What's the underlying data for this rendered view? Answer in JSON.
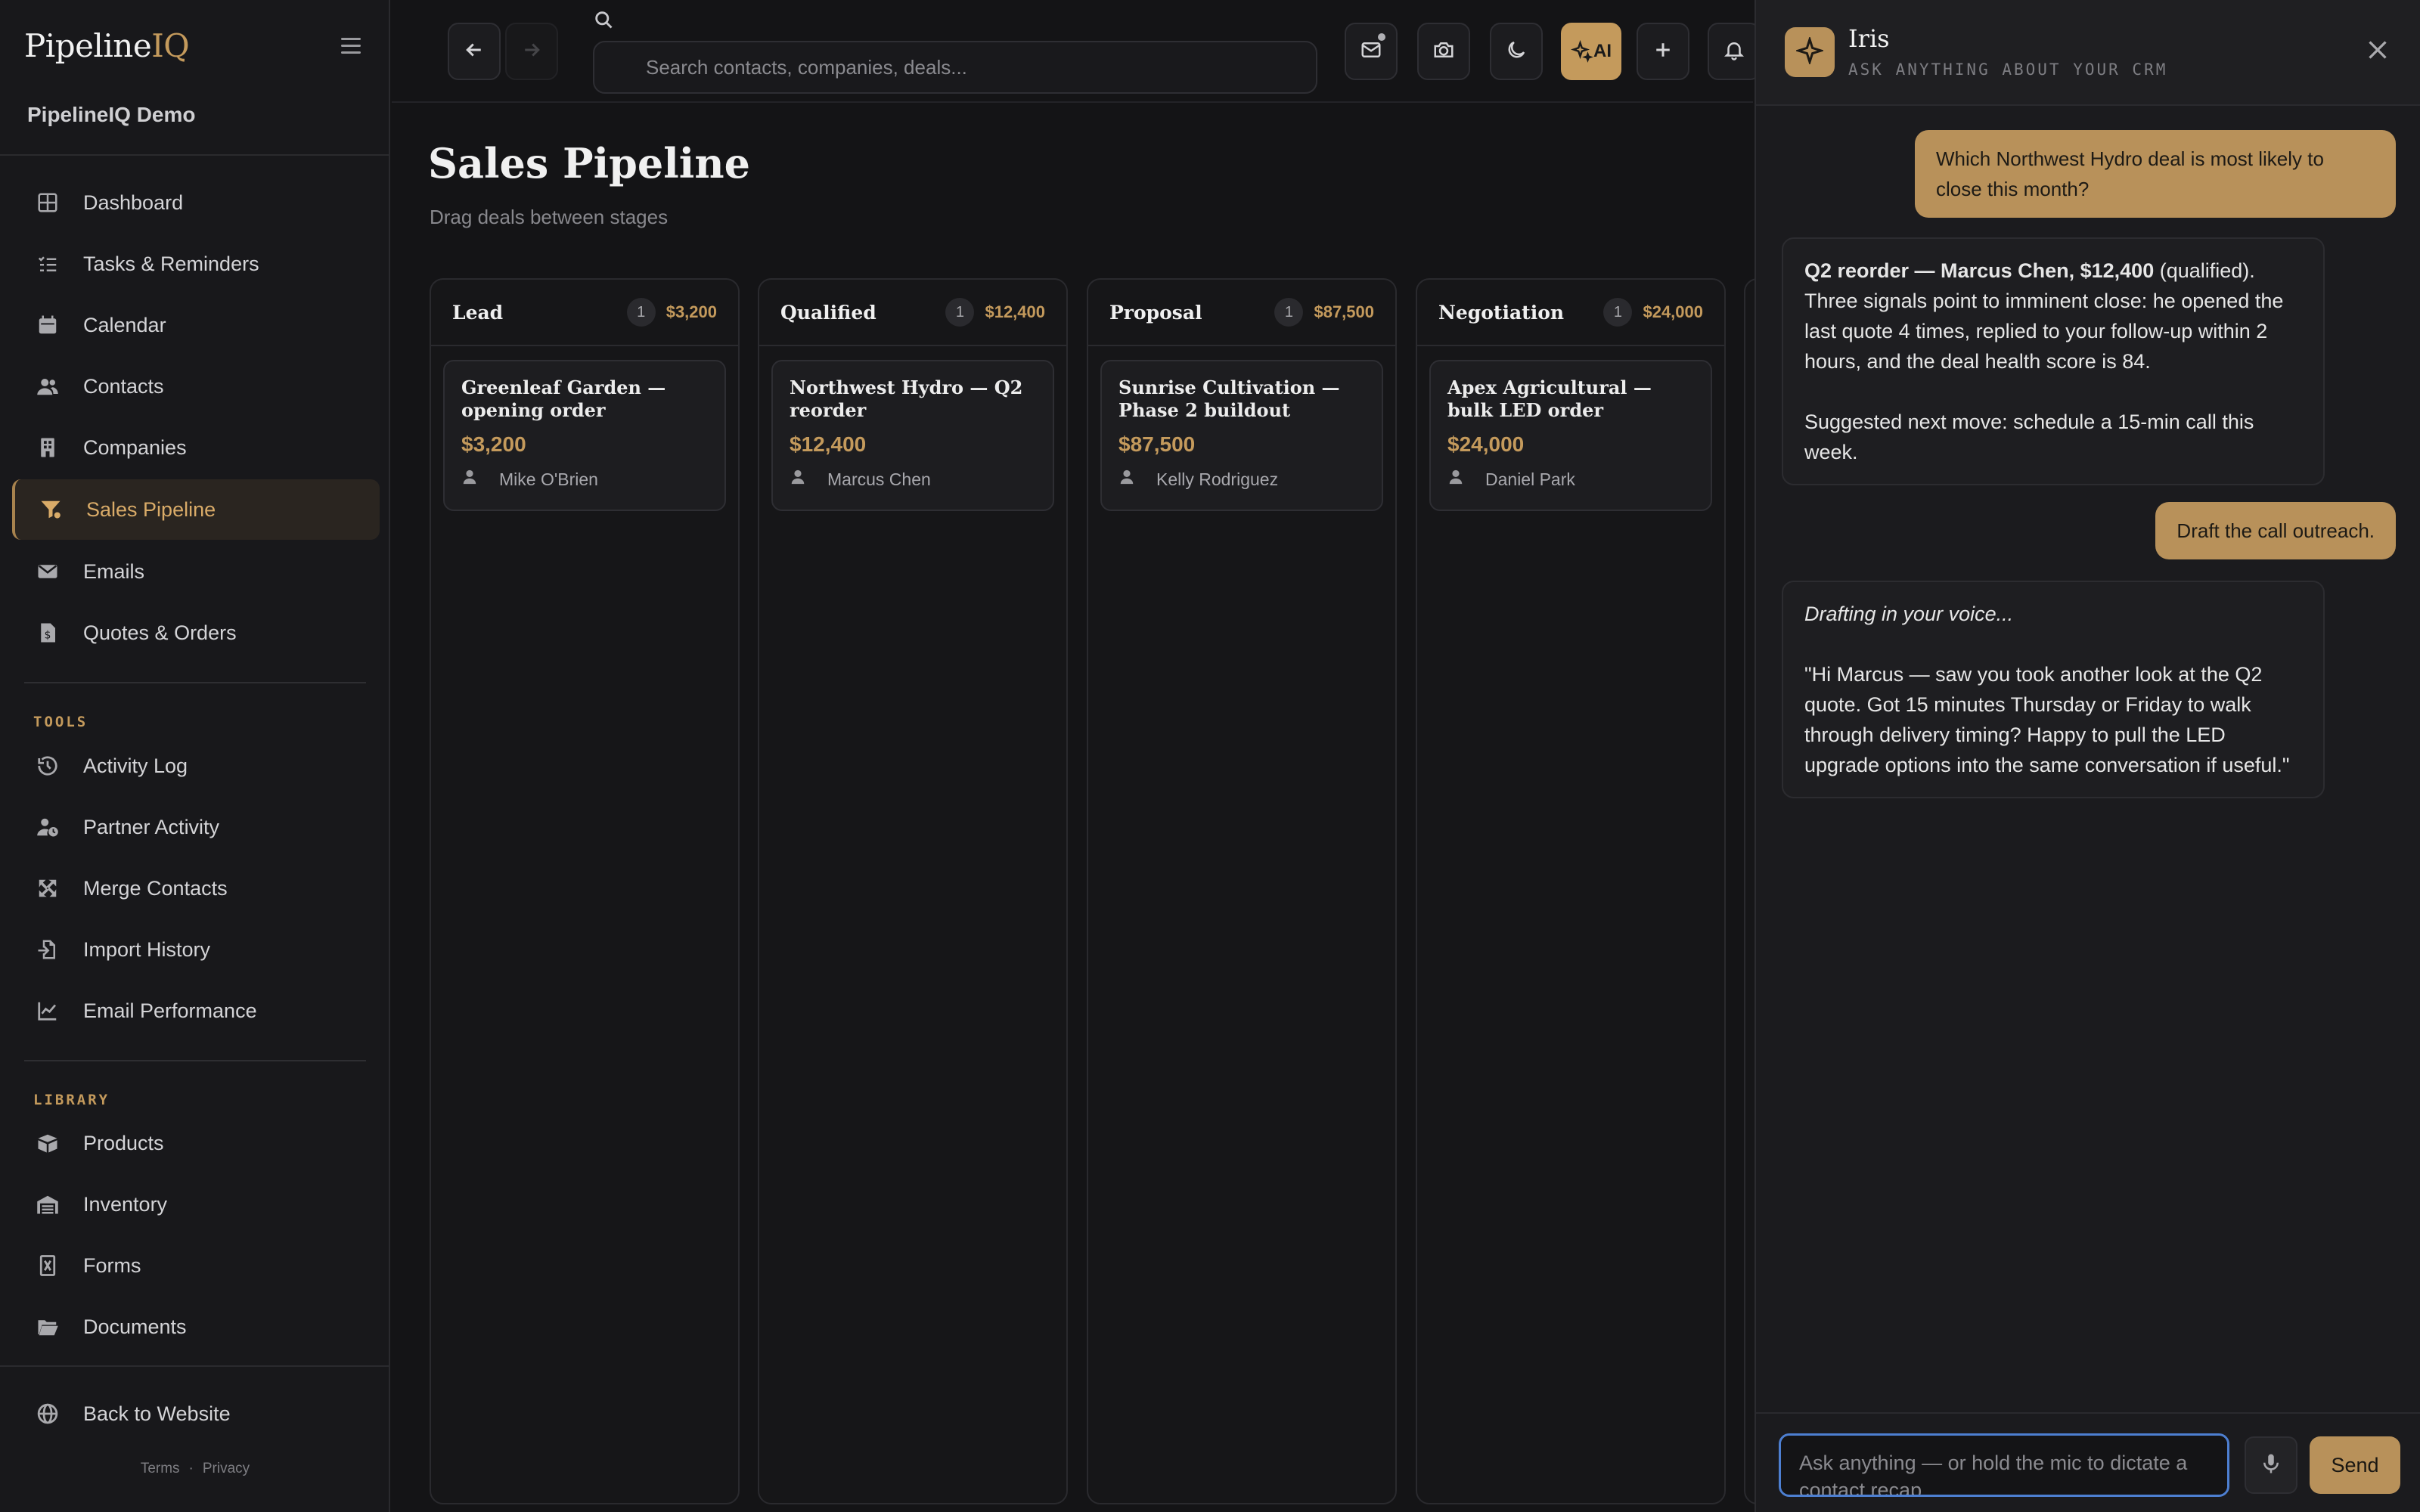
{
  "brand": {
    "name": "Pipeline",
    "accent": "IQ"
  },
  "workspace": "PipelineIQ Demo",
  "nav": {
    "main": [
      {
        "label": "Dashboard",
        "icon": "grid-icon"
      },
      {
        "label": "Tasks & Reminders",
        "icon": "checklist-icon"
      },
      {
        "label": "Calendar",
        "icon": "calendar-icon"
      },
      {
        "label": "Contacts",
        "icon": "users-icon"
      },
      {
        "label": "Companies",
        "icon": "building-icon"
      },
      {
        "label": "Sales Pipeline",
        "icon": "funnel-icon",
        "active": true
      },
      {
        "label": "Emails",
        "icon": "mail-icon"
      },
      {
        "label": "Quotes & Orders",
        "icon": "invoice-icon"
      }
    ],
    "tools_label": "TOOLS",
    "tools": [
      {
        "label": "Activity Log",
        "icon": "history-icon"
      },
      {
        "label": "Partner Activity",
        "icon": "user-clock-icon"
      },
      {
        "label": "Merge Contacts",
        "icon": "merge-icon"
      },
      {
        "label": "Import History",
        "icon": "import-icon"
      },
      {
        "label": "Email Performance",
        "icon": "line-chart-icon"
      }
    ],
    "library_label": "LIBRARY",
    "library": [
      {
        "label": "Products",
        "icon": "box-icon"
      },
      {
        "label": "Inventory",
        "icon": "warehouse-icon"
      },
      {
        "label": "Forms",
        "icon": "form-icon"
      },
      {
        "label": "Documents",
        "icon": "folder-icon"
      }
    ],
    "back": {
      "label": "Back to Website",
      "icon": "globe-icon"
    },
    "footer": {
      "terms": "Terms",
      "separator": "·",
      "privacy": "Privacy"
    }
  },
  "topbar": {
    "search_placeholder": "Search contacts, companies, deals...",
    "ai_label": "AI"
  },
  "main": {
    "title": "Sales Pipeline",
    "subtitle": "Drag deals between stages",
    "columns": [
      {
        "title": "Lead",
        "count": "1",
        "total": "$3,200",
        "deals": [
          {
            "name": "Greenleaf Garden — opening order",
            "amount": "$3,200",
            "owner": "Mike O'Brien"
          }
        ]
      },
      {
        "title": "Qualified",
        "count": "1",
        "total": "$12,400",
        "deals": [
          {
            "name": "Northwest Hydro — Q2 reorder",
            "amount": "$12,400",
            "owner": "Marcus Chen"
          }
        ]
      },
      {
        "title": "Proposal",
        "count": "1",
        "total": "$87,500",
        "deals": [
          {
            "name": "Sunrise Cultivation — Phase 2 buildout",
            "amount": "$87,500",
            "owner": "Kelly Rodriguez"
          }
        ]
      },
      {
        "title": "Negotiation",
        "count": "1",
        "total": "$24,000",
        "deals": [
          {
            "name": "Apex Agricultural — bulk LED order",
            "amount": "$24,000",
            "owner": "Daniel Park"
          }
        ]
      }
    ]
  },
  "assistant": {
    "name": "Iris",
    "subtitle": "ASK ANYTHING ABOUT YOUR CRM",
    "messages": {
      "user1": "Which Northwest Hydro deal is most likely to close this month?",
      "bot1_bold": "Q2 reorder — Marcus Chen, $12,400",
      "bot1_rest": " (qualified). Three signals point to imminent close: he opened the last quote 4 times, replied to your follow-up within 2 hours, and the deal health score is 84.",
      "bot1_next": "Suggested next move: schedule a 15-min call this week.",
      "user2": "Draft the call outreach.",
      "bot2_intro": "Drafting in your voice...",
      "bot2_body": "\"Hi Marcus — saw you took another look at the Q2 quote. Got 15 minutes Thursday or Friday to walk through delivery timing? Happy to pull the LED upgrade options into the same conversation if useful.\""
    },
    "composer_placeholder": "Ask anything — or hold the mic to dictate a contact recap",
    "send_label": "Send"
  },
  "colors": {
    "accent": "#c49a5c",
    "background": "#141416",
    "focus": "#4d7fd1"
  }
}
